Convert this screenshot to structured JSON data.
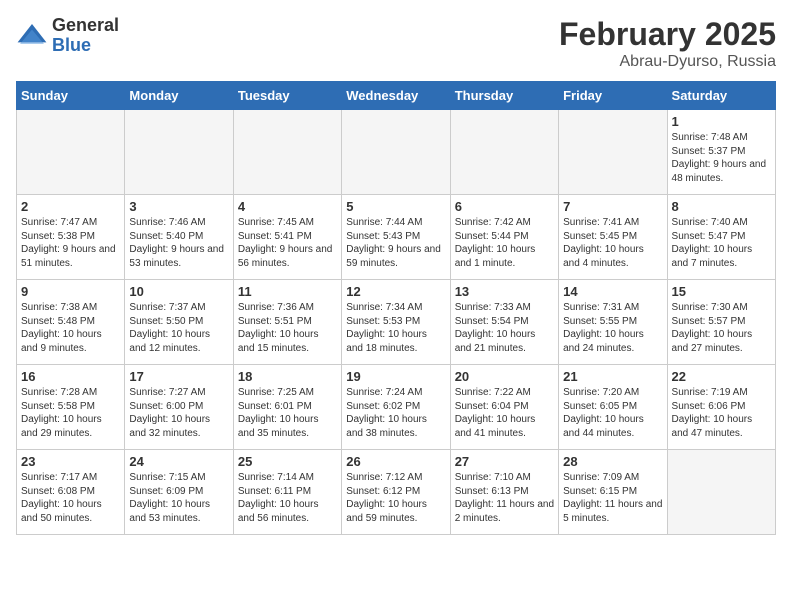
{
  "header": {
    "logo_general": "General",
    "logo_blue": "Blue",
    "month_year": "February 2025",
    "location": "Abrau-Dyurso, Russia"
  },
  "days_of_week": [
    "Sunday",
    "Monday",
    "Tuesday",
    "Wednesday",
    "Thursday",
    "Friday",
    "Saturday"
  ],
  "weeks": [
    [
      {
        "day": "",
        "info": ""
      },
      {
        "day": "",
        "info": ""
      },
      {
        "day": "",
        "info": ""
      },
      {
        "day": "",
        "info": ""
      },
      {
        "day": "",
        "info": ""
      },
      {
        "day": "",
        "info": ""
      },
      {
        "day": "1",
        "info": "Sunrise: 7:48 AM\nSunset: 5:37 PM\nDaylight: 9 hours\nand 48 minutes."
      }
    ],
    [
      {
        "day": "2",
        "info": "Sunrise: 7:47 AM\nSunset: 5:38 PM\nDaylight: 9 hours\nand 51 minutes."
      },
      {
        "day": "3",
        "info": "Sunrise: 7:46 AM\nSunset: 5:40 PM\nDaylight: 9 hours\nand 53 minutes."
      },
      {
        "day": "4",
        "info": "Sunrise: 7:45 AM\nSunset: 5:41 PM\nDaylight: 9 hours\nand 56 minutes."
      },
      {
        "day": "5",
        "info": "Sunrise: 7:44 AM\nSunset: 5:43 PM\nDaylight: 9 hours\nand 59 minutes."
      },
      {
        "day": "6",
        "info": "Sunrise: 7:42 AM\nSunset: 5:44 PM\nDaylight: 10 hours\nand 1 minute."
      },
      {
        "day": "7",
        "info": "Sunrise: 7:41 AM\nSunset: 5:45 PM\nDaylight: 10 hours\nand 4 minutes."
      },
      {
        "day": "8",
        "info": "Sunrise: 7:40 AM\nSunset: 5:47 PM\nDaylight: 10 hours\nand 7 minutes."
      }
    ],
    [
      {
        "day": "9",
        "info": "Sunrise: 7:38 AM\nSunset: 5:48 PM\nDaylight: 10 hours\nand 9 minutes."
      },
      {
        "day": "10",
        "info": "Sunrise: 7:37 AM\nSunset: 5:50 PM\nDaylight: 10 hours\nand 12 minutes."
      },
      {
        "day": "11",
        "info": "Sunrise: 7:36 AM\nSunset: 5:51 PM\nDaylight: 10 hours\nand 15 minutes."
      },
      {
        "day": "12",
        "info": "Sunrise: 7:34 AM\nSunset: 5:53 PM\nDaylight: 10 hours\nand 18 minutes."
      },
      {
        "day": "13",
        "info": "Sunrise: 7:33 AM\nSunset: 5:54 PM\nDaylight: 10 hours\nand 21 minutes."
      },
      {
        "day": "14",
        "info": "Sunrise: 7:31 AM\nSunset: 5:55 PM\nDaylight: 10 hours\nand 24 minutes."
      },
      {
        "day": "15",
        "info": "Sunrise: 7:30 AM\nSunset: 5:57 PM\nDaylight: 10 hours\nand 27 minutes."
      }
    ],
    [
      {
        "day": "16",
        "info": "Sunrise: 7:28 AM\nSunset: 5:58 PM\nDaylight: 10 hours\nand 29 minutes."
      },
      {
        "day": "17",
        "info": "Sunrise: 7:27 AM\nSunset: 6:00 PM\nDaylight: 10 hours\nand 32 minutes."
      },
      {
        "day": "18",
        "info": "Sunrise: 7:25 AM\nSunset: 6:01 PM\nDaylight: 10 hours\nand 35 minutes."
      },
      {
        "day": "19",
        "info": "Sunrise: 7:24 AM\nSunset: 6:02 PM\nDaylight: 10 hours\nand 38 minutes."
      },
      {
        "day": "20",
        "info": "Sunrise: 7:22 AM\nSunset: 6:04 PM\nDaylight: 10 hours\nand 41 minutes."
      },
      {
        "day": "21",
        "info": "Sunrise: 7:20 AM\nSunset: 6:05 PM\nDaylight: 10 hours\nand 44 minutes."
      },
      {
        "day": "22",
        "info": "Sunrise: 7:19 AM\nSunset: 6:06 PM\nDaylight: 10 hours\nand 47 minutes."
      }
    ],
    [
      {
        "day": "23",
        "info": "Sunrise: 7:17 AM\nSunset: 6:08 PM\nDaylight: 10 hours\nand 50 minutes."
      },
      {
        "day": "24",
        "info": "Sunrise: 7:15 AM\nSunset: 6:09 PM\nDaylight: 10 hours\nand 53 minutes."
      },
      {
        "day": "25",
        "info": "Sunrise: 7:14 AM\nSunset: 6:11 PM\nDaylight: 10 hours\nand 56 minutes."
      },
      {
        "day": "26",
        "info": "Sunrise: 7:12 AM\nSunset: 6:12 PM\nDaylight: 10 hours\nand 59 minutes."
      },
      {
        "day": "27",
        "info": "Sunrise: 7:10 AM\nSunset: 6:13 PM\nDaylight: 11 hours\nand 2 minutes."
      },
      {
        "day": "28",
        "info": "Sunrise: 7:09 AM\nSunset: 6:15 PM\nDaylight: 11 hours\nand 5 minutes."
      },
      {
        "day": "",
        "info": ""
      }
    ]
  ]
}
